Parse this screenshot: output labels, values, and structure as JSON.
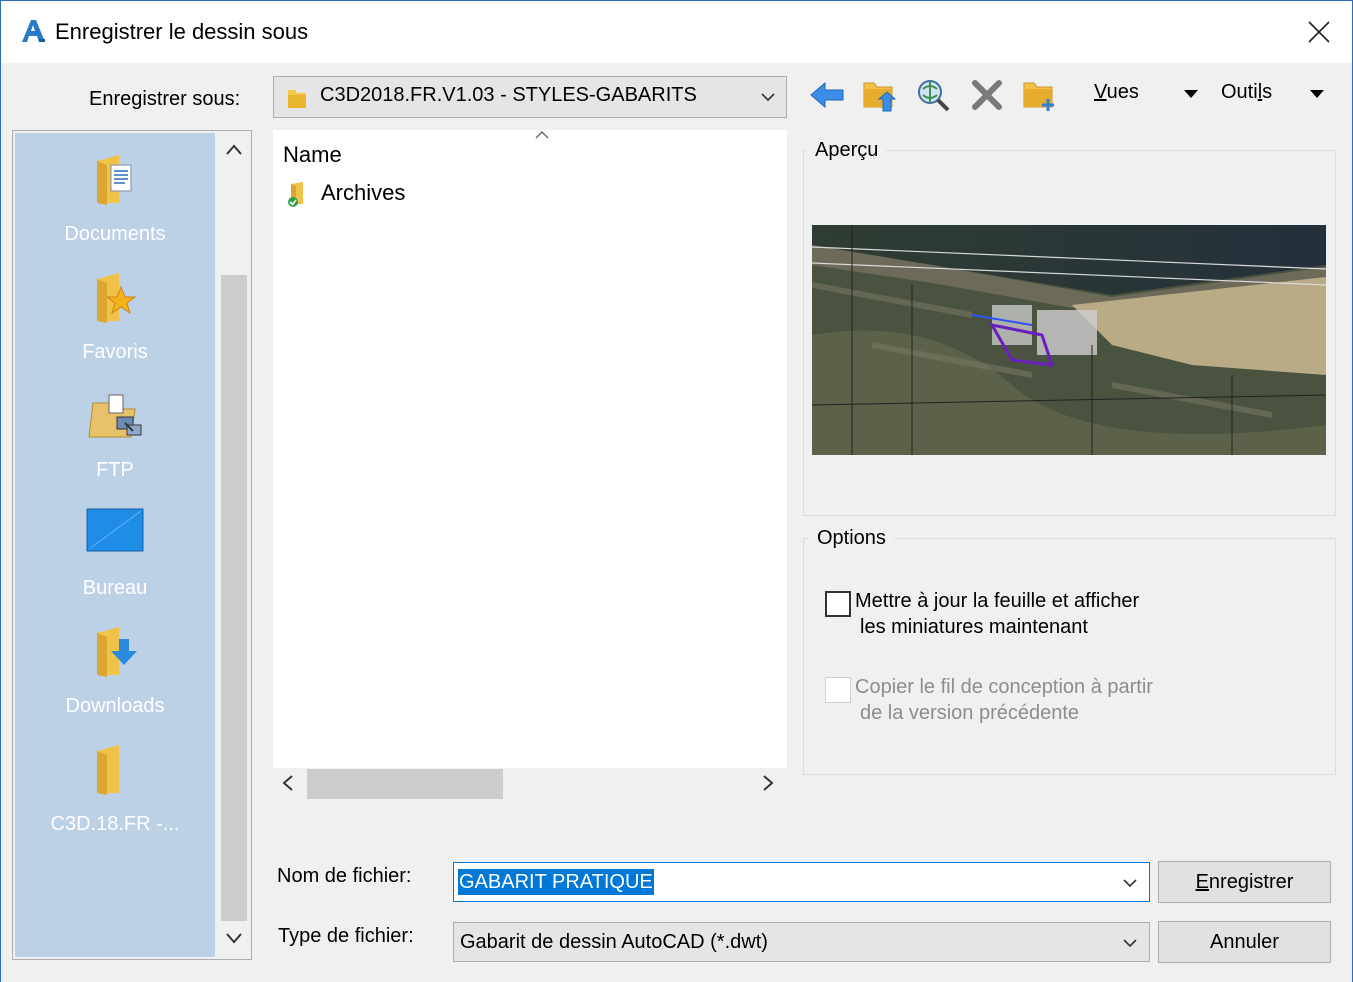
{
  "window": {
    "title": "Enregistrer le dessin sous"
  },
  "toolbar": {
    "save_in_label": "Enregistrer sous:",
    "save_in_value": "C3D2018.FR.V1.03 - STYLES-GABARITS",
    "menu_vues_prefix": "V",
    "menu_vues_rest": "ues",
    "menu_outils_prefix": "Outi",
    "menu_outils_key": "l",
    "menu_outils_rest": "s",
    "icons": [
      "back-arrow-icon",
      "up-folder-icon",
      "search-web-icon",
      "delete-icon",
      "new-folder-icon"
    ]
  },
  "places": [
    {
      "label": "Documents",
      "icon": "documents-folder-icon"
    },
    {
      "label": "Favoris",
      "icon": "favorites-folder-icon"
    },
    {
      "label": "FTP",
      "icon": "ftp-folder-icon"
    },
    {
      "label": "Bureau",
      "icon": "desktop-icon"
    },
    {
      "label": "Downloads",
      "icon": "downloads-folder-icon"
    },
    {
      "label": "C3D.18.FR -...",
      "icon": "folder-icon"
    }
  ],
  "file_list": {
    "column_name": "Name",
    "items": [
      {
        "name": "Archives",
        "icon": "synced-folder-icon"
      }
    ]
  },
  "preview": {
    "legend": "Aperçu"
  },
  "options": {
    "legend": "Options",
    "opt1_line1": "Mettre à jour la feuille et afficher",
    "opt1_line2": "les miniatures maintenant",
    "opt1_checked": false,
    "opt2_line1": "Copier le fil de conception à partir",
    "opt2_line2": "de la version précédente",
    "opt2_checked": false,
    "opt2_enabled": false
  },
  "form": {
    "filename_label": "Nom de fichier:",
    "filename_value": "GABARIT PRATIQUE",
    "filetype_label": "Type de fichier:",
    "filetype_value": "Gabarit de dessin AutoCAD (*.dwt)"
  },
  "buttons": {
    "save_key": "E",
    "save_rest": "nregistrer",
    "cancel": "Annuler"
  },
  "colors": {
    "accent": "#0078d7",
    "places_bg": "#bcd0e6",
    "window_border": "#2b6cc4"
  }
}
